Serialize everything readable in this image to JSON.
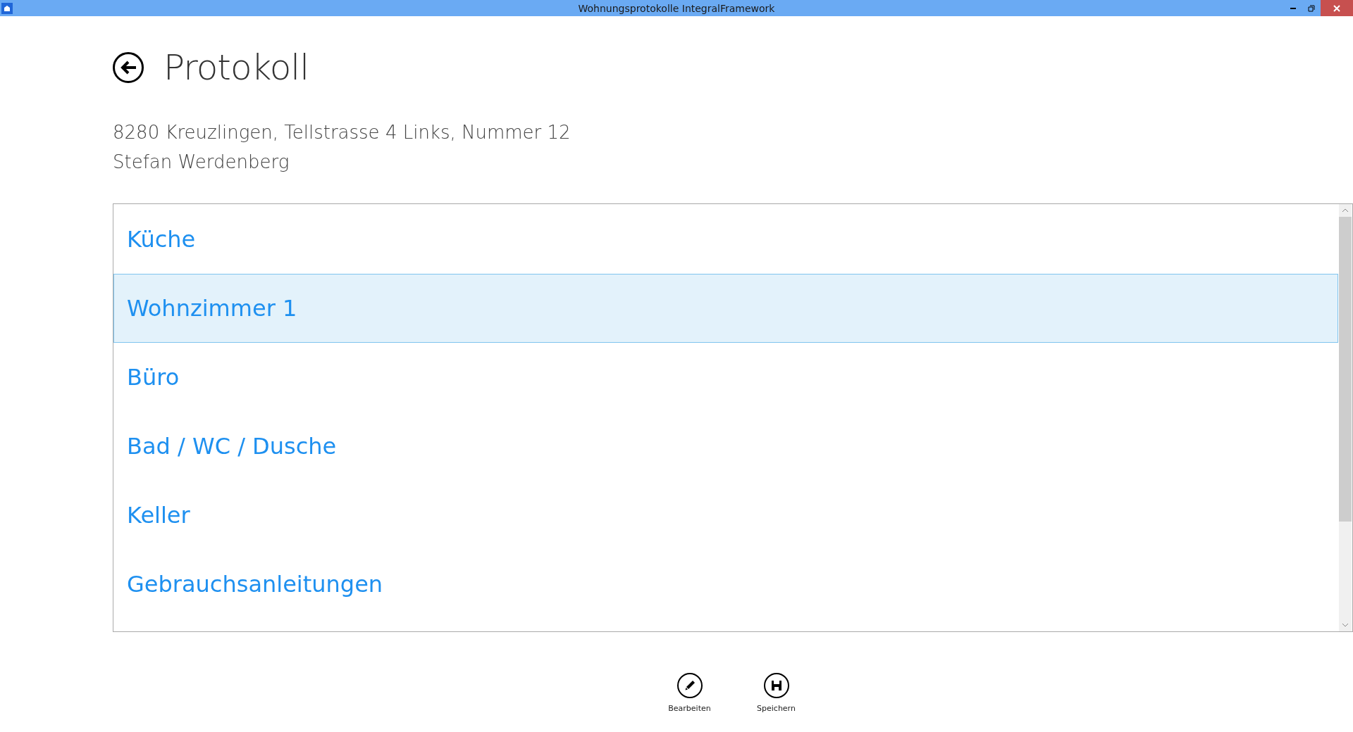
{
  "window": {
    "title": "Wohnungsprotokolle IntegralFramework"
  },
  "page": {
    "title": "Protokoll",
    "address": "8280 Kreuzlingen, Tellstrasse 4 Links, Nummer 12",
    "tenant": "Stefan Werdenberg"
  },
  "rooms": [
    {
      "label": "Küche",
      "selected": false
    },
    {
      "label": "Wohnzimmer 1",
      "selected": true
    },
    {
      "label": "Büro",
      "selected": false
    },
    {
      "label": "Bad / WC / Dusche",
      "selected": false
    },
    {
      "label": "Keller",
      "selected": false
    },
    {
      "label": "Gebrauchsanleitungen",
      "selected": false
    }
  ],
  "app_bar": [
    {
      "kind": "edit",
      "label": "Bearbeiten"
    },
    {
      "kind": "save",
      "label": "Speichern"
    }
  ]
}
